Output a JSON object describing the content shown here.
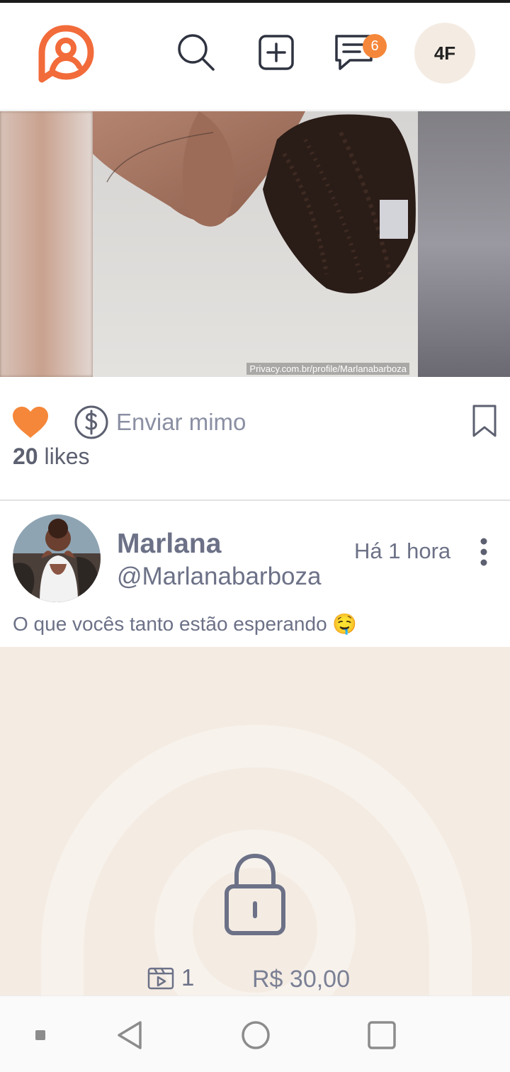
{
  "header": {
    "messages_badge": "6",
    "avatar_initials": "4F",
    "accent_color": "#f5873a"
  },
  "media": {
    "watermark": "Privacy.com.br/profile/Marlanabarboza"
  },
  "actions": {
    "tip_label": "Enviar mimo",
    "likes_count": "20",
    "likes_word": "likes"
  },
  "post": {
    "author_name": "Marlana",
    "author_handle": "@Marlanabarboza",
    "time_ago": "Há 1 hora",
    "caption": "O que vocês tanto estão esperando 🤤"
  },
  "locked": {
    "media_count": "1",
    "price": "R$ 30,00"
  },
  "icons": [
    "logo-icon",
    "search-icon",
    "add-post-icon",
    "messages-icon",
    "heart-icon",
    "dollar-icon",
    "bookmark-icon",
    "more-vertical-icon",
    "lock-icon",
    "video-icon",
    "nav-square-icon",
    "nav-back-icon",
    "nav-home-icon",
    "nav-recents-icon"
  ]
}
